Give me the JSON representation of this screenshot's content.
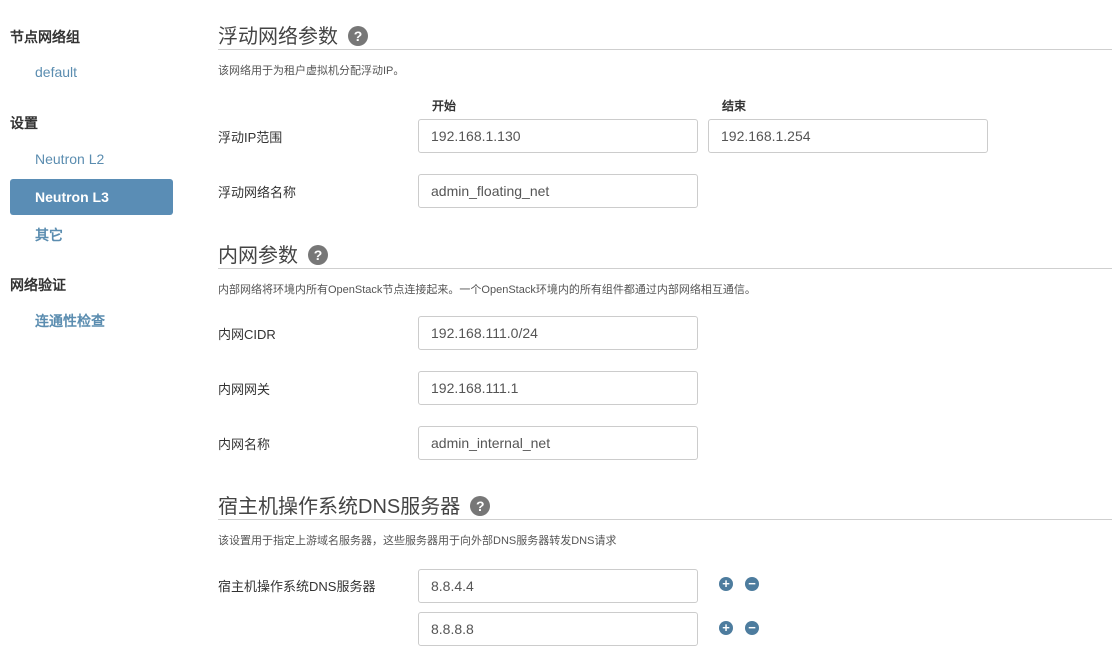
{
  "sidebar": {
    "groups": [
      {
        "title": "节点网络组",
        "items": [
          "default"
        ]
      },
      {
        "title": "设置",
        "items": [
          "Neutron L2",
          "Neutron L3",
          "其它"
        ]
      },
      {
        "title": "网络验证",
        "items": [
          "连通性检查"
        ]
      }
    ],
    "active_item": "Neutron L3"
  },
  "floating": {
    "title": "浮动网络参数",
    "description": "该网络用于为租户虚拟机分配浮动IP。",
    "range_label": "浮动IP范围",
    "start_header": "开始",
    "end_header": "结束",
    "start_value": "192.168.1.130",
    "end_value": "192.168.1.254",
    "name_label": "浮动网络名称",
    "name_value": "admin_floating_net"
  },
  "internal": {
    "title": "内网参数",
    "description": "内部网络将环境内所有OpenStack节点连接起来。一个OpenStack环境内的所有组件都通过内部网络相互通信。",
    "cidr_label": "内网CIDR",
    "cidr_value": "192.168.111.0/24",
    "gateway_label": "内网网关",
    "gateway_value": "192.168.111.1",
    "name_label": "内网名称",
    "name_value": "admin_internal_net"
  },
  "dns": {
    "title": "宿主机操作系统DNS服务器",
    "description": "该设置用于指定上游域名服务器，这些服务器用于向外部DNS服务器转发DNS请求",
    "label": "宿主机操作系统DNS服务器",
    "servers": [
      "8.8.4.4",
      "8.8.8.8"
    ]
  },
  "icons": {
    "help": "question-circle-icon",
    "add": "plus-circle-icon",
    "remove": "minus-circle-icon"
  },
  "colors": {
    "nav_active_bg": "#5a8db5",
    "nav_link": "#5b8db0",
    "icon_button": "#4d7c9e"
  }
}
